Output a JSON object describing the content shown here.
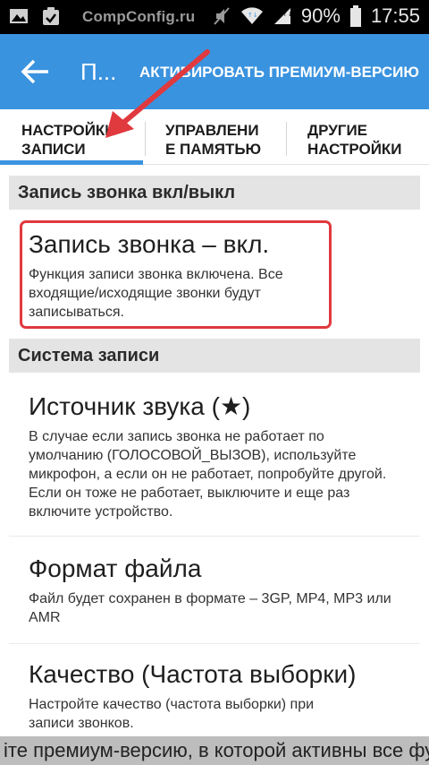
{
  "status_bar": {
    "watermark": "CompConfig.ru",
    "battery_percent": "90%",
    "time": "17:55",
    "icons": [
      "image-icon",
      "clipboard-check-icon",
      "mute-icon",
      "wifi-icon",
      "signal-icon",
      "battery-icon"
    ]
  },
  "app_bar": {
    "title": "П...",
    "premium_label": "АКТИВИРОВАТЬ ПРЕМИУМ-ВЕРСИЮ",
    "color": "#3a93df"
  },
  "tabs": [
    {
      "line1": "НАСТРОЙКИ",
      "line2": "ЗАПИСИ",
      "selected": true
    },
    {
      "line1": "УПРАВЛЕНИ",
      "line2": "Е ПАМЯТЬЮ",
      "selected": false
    },
    {
      "line1": "ДРУГИЕ",
      "line2": "НАСТРОЙКИ",
      "selected": false
    }
  ],
  "sections": {
    "recording_toggle": {
      "header": "Запись звонка вкл/выкл",
      "item": {
        "title": "Запись звонка – вкл.",
        "desc": "Функция записи звонка включена. Все входящие/исходящие звонки будут записываться."
      }
    },
    "recording_system": {
      "header": "Система записи",
      "source": {
        "title": "Источник звука (★)",
        "desc": "В случае если запись звонка не работает по умолчанию (ГОЛОСОВОЙ_ВЫЗОВ), используйте микрофон, а если он не работает, попробуйте другой. Если он тоже не работает, выключите и еще раз включите устройство."
      },
      "format": {
        "title": "Формат файла",
        "desc": "Файл будет сохранен в формате – 3GP, MP4, MP3 или AMR"
      },
      "quality": {
        "title": "Качество (Частота выборки)",
        "desc": "Настройте качество (частота выборки) при записи звонков."
      }
    }
  },
  "ticker": "іте премиум-версию, в которой активны все фу",
  "annotation_color": "#e0393e"
}
